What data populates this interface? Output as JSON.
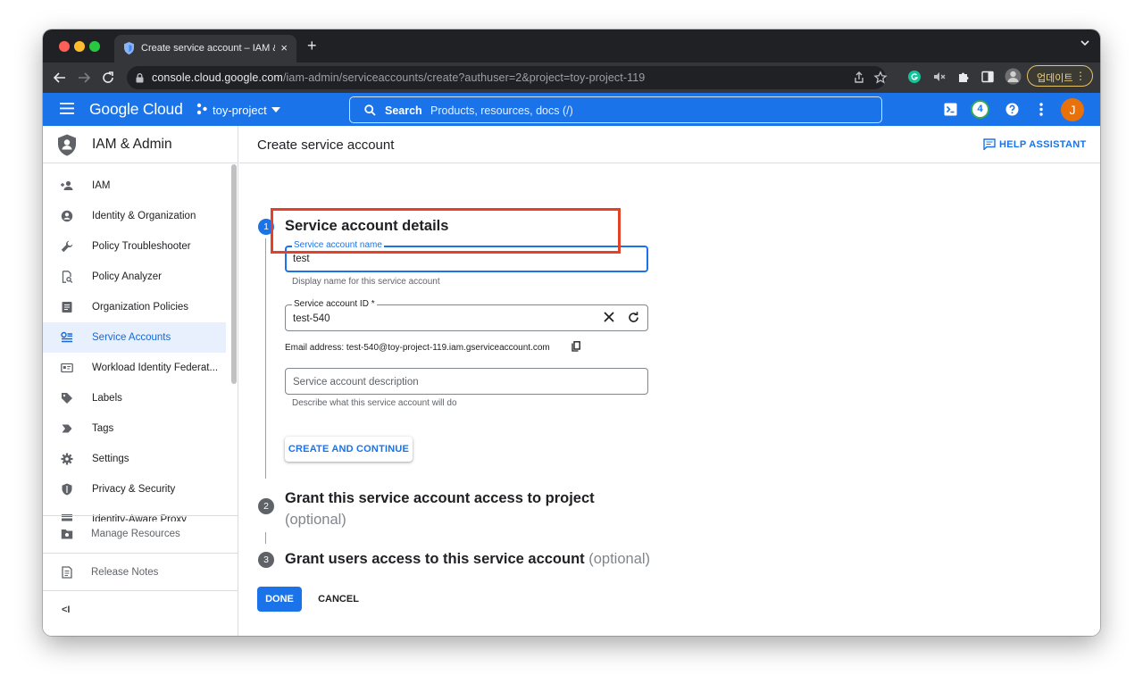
{
  "browser": {
    "tab_title": "Create service account – IAM & Admin",
    "tab_close": "×",
    "new_tab": "+",
    "url_host": "console.cloud.google.com",
    "url_path": "/iam-admin/serviceaccounts/create?authuser=2&project=toy-project-119",
    "update_label": "업데이트",
    "update_menu": "⋮"
  },
  "gcp": {
    "logo": "Google Cloud",
    "project": "toy-project",
    "search_label": "Search",
    "search_placeholder": "Products, resources, docs (/)",
    "notifications": "4",
    "avatar_initial": "J"
  },
  "sidebar": {
    "title": "IAM & Admin",
    "items": [
      {
        "label": "IAM",
        "icon": "person-add-icon"
      },
      {
        "label": "Identity & Organization",
        "icon": "account-circle-icon"
      },
      {
        "label": "Policy Troubleshooter",
        "icon": "wrench-icon"
      },
      {
        "label": "Policy Analyzer",
        "icon": "document-search-icon"
      },
      {
        "label": "Organization Policies",
        "icon": "policy-document-icon"
      },
      {
        "label": "Service Accounts",
        "icon": "service-account-icon",
        "active": true
      },
      {
        "label": "Workload Identity Federat...",
        "icon": "id-card-icon"
      },
      {
        "label": "Labels",
        "icon": "label-icon"
      },
      {
        "label": "Tags",
        "icon": "tag-icon"
      },
      {
        "label": "Settings",
        "icon": "gear-icon"
      },
      {
        "label": "Privacy & Security",
        "icon": "shield-icon"
      },
      {
        "label": "Identity-Aware Proxy",
        "icon": "proxy-icon"
      }
    ],
    "manage_resources": "Manage Resources",
    "release_notes": "Release Notes",
    "collapse": "<I"
  },
  "main": {
    "page_title": "Create service account",
    "help_assistant": "HELP ASSISTANT",
    "step1": {
      "num": "1",
      "title": "Service account details",
      "name_label": "Service account name",
      "name_value": "test",
      "name_hint": "Display name for this service account",
      "id_label": "Service account ID *",
      "id_value": "test-540",
      "email": "Email address: test-540@toy-project-119.iam.gserviceaccount.com",
      "desc_placeholder": "Service account description",
      "desc_hint": "Describe what this service account will do",
      "create_button": "CREATE AND CONTINUE"
    },
    "step2": {
      "num": "2",
      "title": "Grant this service account access to project",
      "optional": "(optional)"
    },
    "step3": {
      "num": "3",
      "title": "Grant users access to this service account",
      "optional": "(optional)"
    },
    "done_button": "DONE",
    "cancel_button": "CANCEL"
  },
  "colors": {
    "gcp_blue": "#1a73e8",
    "highlight_red": "#e4412b",
    "active_bg": "#e8f0fe"
  }
}
